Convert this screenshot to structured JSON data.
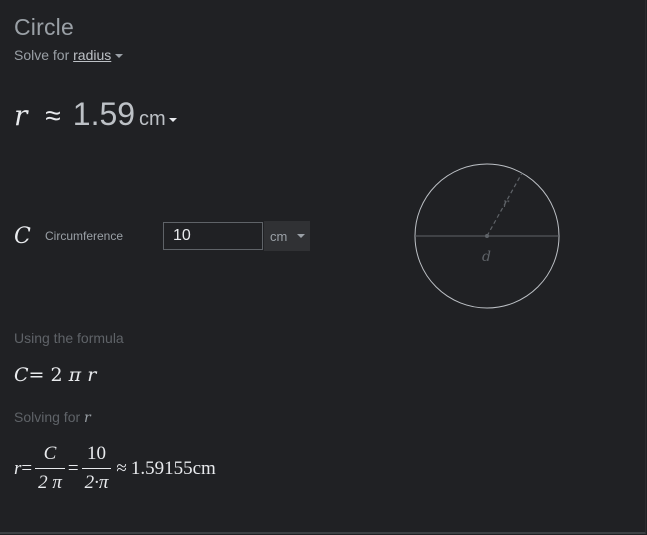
{
  "title": "Circle",
  "solve_for": {
    "prefix": "Solve for",
    "selected": "radius"
  },
  "result": {
    "variable": "r",
    "approx_symbol": "≈",
    "value": "1.59",
    "unit": "cm"
  },
  "input": {
    "variable": "C",
    "label": "Circumference",
    "value": "10",
    "unit": "cm"
  },
  "diagram": {
    "radius_label": "r",
    "diameter_label": "d",
    "stroke_color": "#bdc1c6",
    "line_color": "#5f6368"
  },
  "formula": {
    "heading": "Using the formula",
    "lhs": "C",
    "equals": "=",
    "rhs_coef": "2",
    "rhs_pi": "π",
    "rhs_var": "r"
  },
  "solving": {
    "heading": "Solving for",
    "variable": "r"
  },
  "solution": {
    "lhs": "r",
    "eq1": "=",
    "frac1_num": "C",
    "frac1_den": "2 π",
    "eq2": "=",
    "frac2_num": "10",
    "frac2_den": "2·π",
    "approx": "≈",
    "value": "1.59155cm"
  }
}
